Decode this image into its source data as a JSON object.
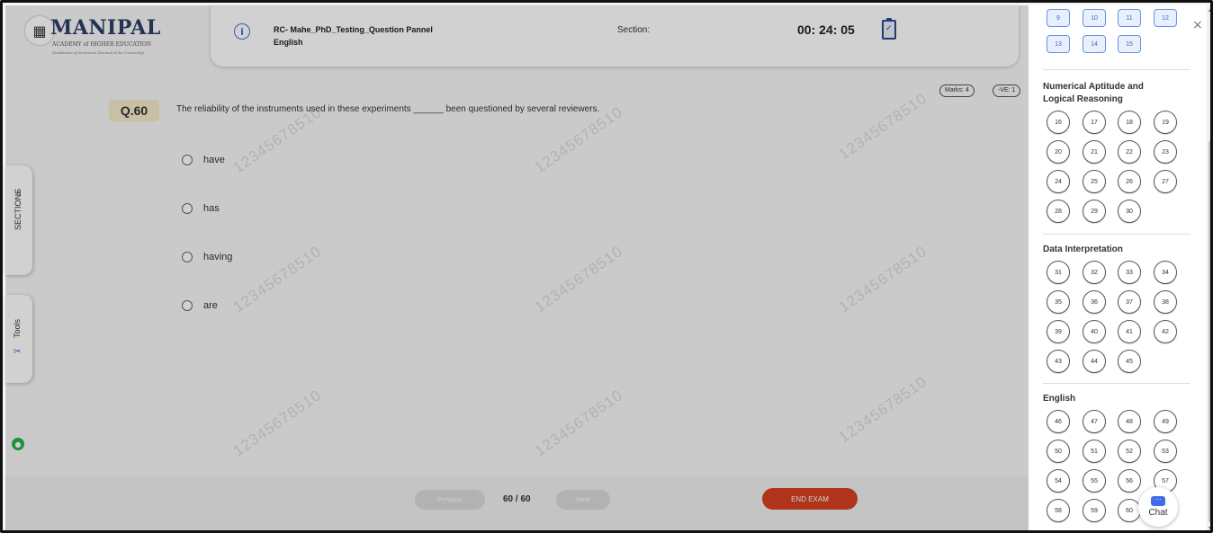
{
  "logo": {
    "brand": "MANIPAL",
    "sub": "ACADEMY of HIGHER EDUCATION",
    "sub2": "(Institution of Eminence Deemed to be University)"
  },
  "header": {
    "exam_title": "RC- Mahe_PhD_Testing_Question Pannel",
    "subject": "English",
    "section_label": "Section:",
    "timer": "00: 24: 05"
  },
  "question": {
    "number": "Q.60",
    "text": "The reliability of the instruments used in these experiments ______ been questioned by several reviewers.",
    "marks": "Marks: 4",
    "negative": "-VE: 1",
    "options": [
      "have",
      "has",
      "having",
      "are"
    ]
  },
  "watermark": "12345678510",
  "side_tabs": {
    "sections": "SECTIONS",
    "sections_arrow": ">",
    "tools": "Tools"
  },
  "footer": {
    "previous": "Previous",
    "page": "60 / 60",
    "next": "Next",
    "end_exam": "END EXAM"
  },
  "palette": {
    "top_squares": [
      "9",
      "10",
      "11",
      "12",
      "13",
      "14",
      "15"
    ],
    "sections": [
      {
        "title_line1": "Numerical Aptitude and",
        "title_line2": "Logical Reasoning",
        "numbers": [
          "16",
          "17",
          "18",
          "19",
          "20",
          "21",
          "22",
          "23",
          "24",
          "25",
          "26",
          "27",
          "28",
          "29",
          "30"
        ]
      },
      {
        "title_line1": "Data Interpretation",
        "title_line2": "",
        "numbers": [
          "31",
          "32",
          "33",
          "34",
          "35",
          "36",
          "37",
          "38",
          "39",
          "40",
          "41",
          "42",
          "43",
          "44",
          "45"
        ]
      },
      {
        "title_line1": "English",
        "title_line2": "",
        "numbers": [
          "46",
          "47",
          "48",
          "49",
          "50",
          "51",
          "52",
          "53",
          "54",
          "55",
          "56",
          "57",
          "58",
          "59",
          "60"
        ]
      }
    ],
    "close": "×",
    "chat": "Chat"
  },
  "colors": {
    "end_exam": "#d6401f",
    "answered_square": "#6a90e8",
    "camera": "#22b24c"
  }
}
